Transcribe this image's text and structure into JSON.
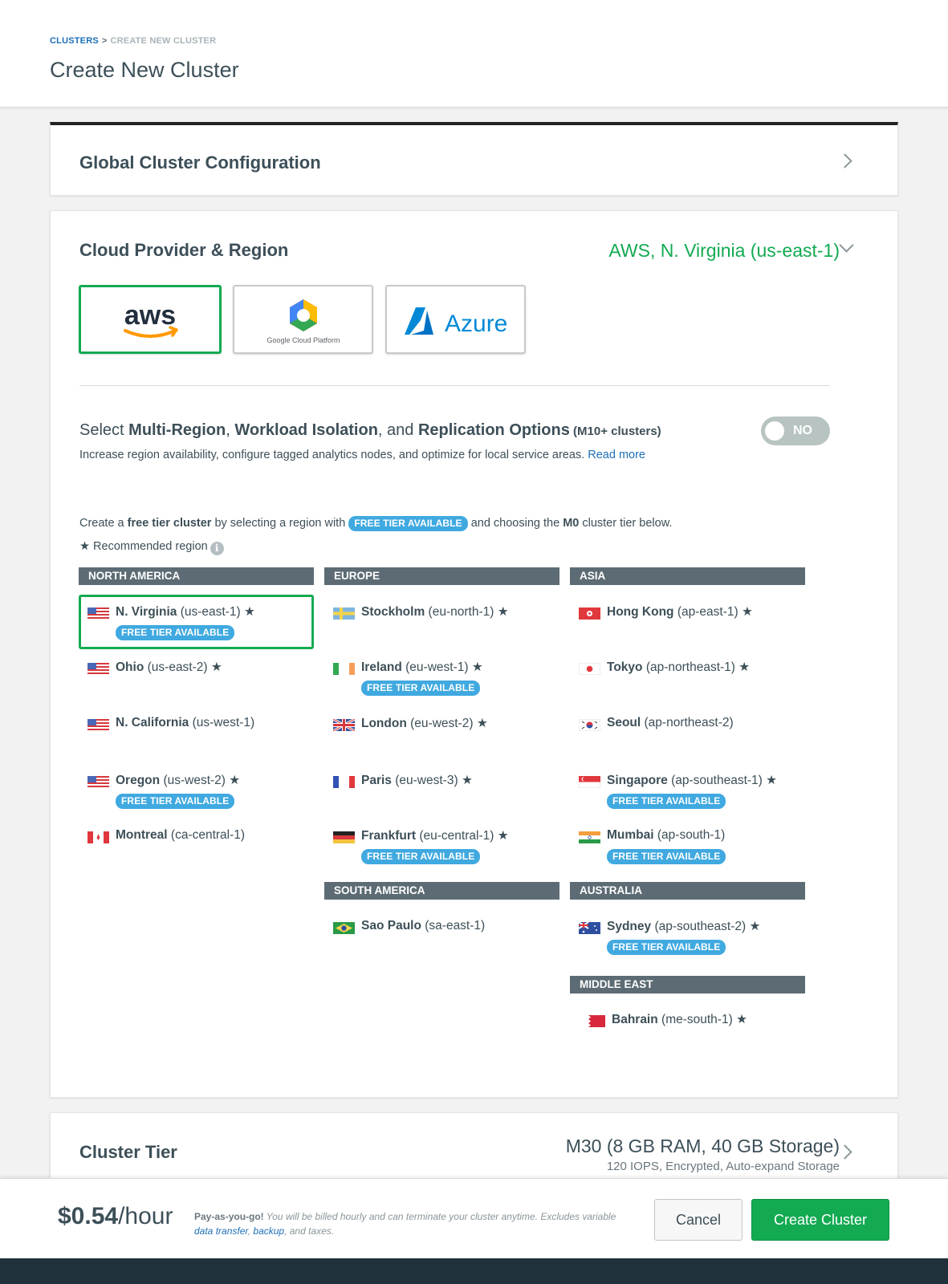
{
  "breadcrumb": {
    "root": "CLUSTERS",
    "separator": ">",
    "current": "CREATE NEW CLUSTER"
  },
  "page_title": "Create New Cluster",
  "global_config": {
    "title": "Global Cluster Configuration"
  },
  "cloud": {
    "title": "Cloud Provider & Region",
    "selected_summary": "AWS, N. Virginia (us-east-1)",
    "providers": [
      {
        "label": "aws",
        "selected": true
      },
      {
        "label": "Google Cloud Platform",
        "selected": false
      },
      {
        "label": "Azure",
        "selected": false
      }
    ],
    "multi_region": {
      "t1": "Select ",
      "t2": "Multi-Region",
      "t3": ", ",
      "t4": "Workload Isolation",
      "t5": ", and ",
      "t6": "Replication Options",
      "t7": " (M10+ clusters)",
      "desc": "Increase region availability, configure tagged analytics nodes, and optimize for local service areas. ",
      "read_more": "Read more",
      "toggle": "NO"
    },
    "free_info": {
      "a": "Create a ",
      "b": "free tier cluster",
      "c": " by selecting a region with ",
      "d": " and choosing the ",
      "e": "M0",
      "f": " cluster tier below."
    },
    "recommended_label": "Recommended region",
    "badge": "FREE TIER AVAILABLE",
    "groups": {
      "north_america": {
        "title": "NORTH AMERICA",
        "regions": [
          {
            "name": "N. Virginia",
            "code": "(us-east-1)",
            "star": "★"
          },
          {
            "name": "Ohio",
            "code": "(us-east-2)",
            "star": "★"
          },
          {
            "name": "N. California",
            "code": "(us-west-1)"
          },
          {
            "name": "Oregon",
            "code": "(us-west-2)",
            "star": "★"
          },
          {
            "name": "Montreal",
            "code": "(ca-central-1)"
          }
        ]
      },
      "europe": {
        "title": "EUROPE",
        "regions": [
          {
            "name": "Stockholm",
            "code": "(eu-north-1)",
            "star": "★"
          },
          {
            "name": "Ireland",
            "code": "(eu-west-1)",
            "star": "★"
          },
          {
            "name": "London",
            "code": "(eu-west-2)",
            "star": "★"
          },
          {
            "name": "Paris",
            "code": "(eu-west-3)",
            "star": "★"
          },
          {
            "name": "Frankfurt",
            "code": "(eu-central-1)",
            "star": "★"
          }
        ]
      },
      "asia": {
        "title": "ASIA",
        "regions": [
          {
            "name": "Hong Kong",
            "code": "(ap-east-1)",
            "star": "★"
          },
          {
            "name": "Tokyo",
            "code": "(ap-northeast-1)",
            "star": "★"
          },
          {
            "name": "Seoul",
            "code": "(ap-northeast-2)"
          },
          {
            "name": "Singapore",
            "code": "(ap-southeast-1)",
            "star": "★"
          },
          {
            "name": "Mumbai",
            "code": "(ap-south-1)"
          }
        ]
      },
      "south_america": {
        "title": "SOUTH AMERICA",
        "regions": [
          {
            "name": "Sao Paulo",
            "code": "(sa-east-1)"
          }
        ]
      },
      "australia": {
        "title": "AUSTRALIA",
        "regions": [
          {
            "name": "Sydney",
            "code": "(ap-southeast-2)",
            "star": "★"
          }
        ]
      },
      "middle_east": {
        "title": "MIDDLE EAST",
        "regions": [
          {
            "name": "Bahrain",
            "code": "(me-south-1)",
            "star": "★"
          }
        ]
      }
    }
  },
  "tier": {
    "title": "Cluster Tier",
    "main": "M30 (8 GB RAM, 40 GB Storage)",
    "sub": "120 IOPS, Encrypted, Auto-expand Storage"
  },
  "footer": {
    "price": "$0.54",
    "per": "/hour",
    "note_bold": "Pay-as-you-go!",
    "note": " You will be billed hourly and can terminate your cluster anytime. Excludes variable ",
    "link1": "data transfer",
    "sep1": ", ",
    "link2": "backup",
    "tail": ", and taxes.",
    "cancel": "Cancel",
    "create": "Create Cluster"
  },
  "colors": {
    "accent_green": "#13aa52",
    "badge_blue": "#40a9e0",
    "link_blue": "#1e6fb8",
    "header_gray": "#5d6c74"
  }
}
